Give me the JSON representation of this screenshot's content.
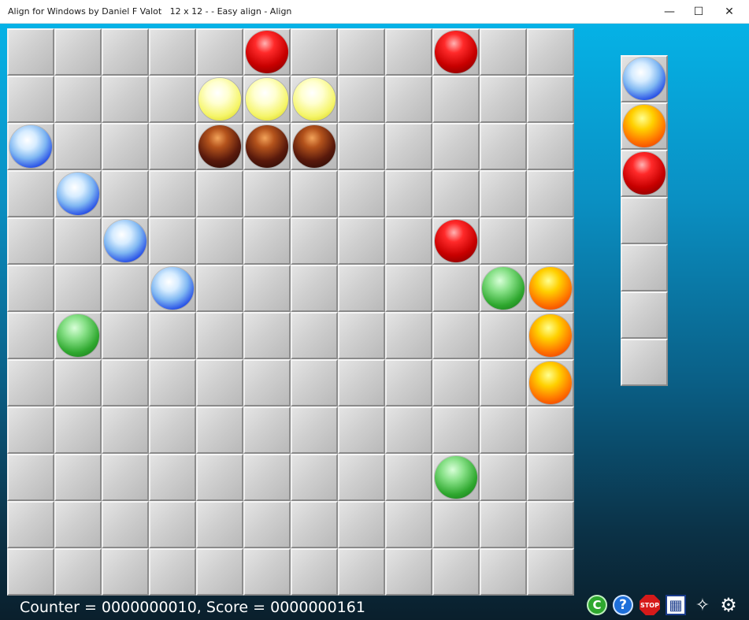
{
  "window": {
    "title": "Align for Windows by Daniel F Valot   12 x 12 - - Easy align - Align",
    "controls": {
      "minimize": "—",
      "maximize": "☐",
      "close": "✕"
    }
  },
  "board": {
    "rows": 12,
    "cols": 12,
    "balls": [
      {
        "row": 0,
        "col": 5,
        "color": "red"
      },
      {
        "row": 0,
        "col": 9,
        "color": "red"
      },
      {
        "row": 1,
        "col": 4,
        "color": "yellow"
      },
      {
        "row": 1,
        "col": 5,
        "color": "yellow"
      },
      {
        "row": 1,
        "col": 6,
        "color": "yellow"
      },
      {
        "row": 2,
        "col": 0,
        "color": "blue"
      },
      {
        "row": 2,
        "col": 4,
        "color": "brown"
      },
      {
        "row": 2,
        "col": 5,
        "color": "brown"
      },
      {
        "row": 2,
        "col": 6,
        "color": "brown"
      },
      {
        "row": 3,
        "col": 1,
        "color": "blue"
      },
      {
        "row": 4,
        "col": 2,
        "color": "blue"
      },
      {
        "row": 4,
        "col": 9,
        "color": "red"
      },
      {
        "row": 5,
        "col": 3,
        "color": "blue"
      },
      {
        "row": 5,
        "col": 10,
        "color": "green"
      },
      {
        "row": 5,
        "col": 11,
        "color": "orange"
      },
      {
        "row": 6,
        "col": 1,
        "color": "green"
      },
      {
        "row": 6,
        "col": 11,
        "color": "orange"
      },
      {
        "row": 7,
        "col": 11,
        "color": "orange"
      },
      {
        "row": 9,
        "col": 9,
        "color": "green"
      }
    ]
  },
  "next_panel": {
    "slots": 7,
    "balls": [
      "blue",
      "orange",
      "red"
    ]
  },
  "status": {
    "text": "Counter = 0000000010, Score = 0000000161",
    "counter": "0000000010",
    "score": "0000000161"
  },
  "toolbar": {
    "icons": [
      {
        "name": "copyright-icon",
        "glyph": "C",
        "color": "#2ea82e"
      },
      {
        "name": "help-icon",
        "glyph": "?",
        "color": "#1e6fd9"
      },
      {
        "name": "stop-icon",
        "glyph": "STOP",
        "color": "#d61a1a"
      },
      {
        "name": "scores-table-icon",
        "glyph": "▦",
        "color": "#ffffff"
      },
      {
        "name": "tag-icon",
        "glyph": "✧",
        "color": "#ffffff"
      },
      {
        "name": "gear-icon",
        "glyph": "⚙",
        "color": "#ffffff"
      }
    ]
  }
}
